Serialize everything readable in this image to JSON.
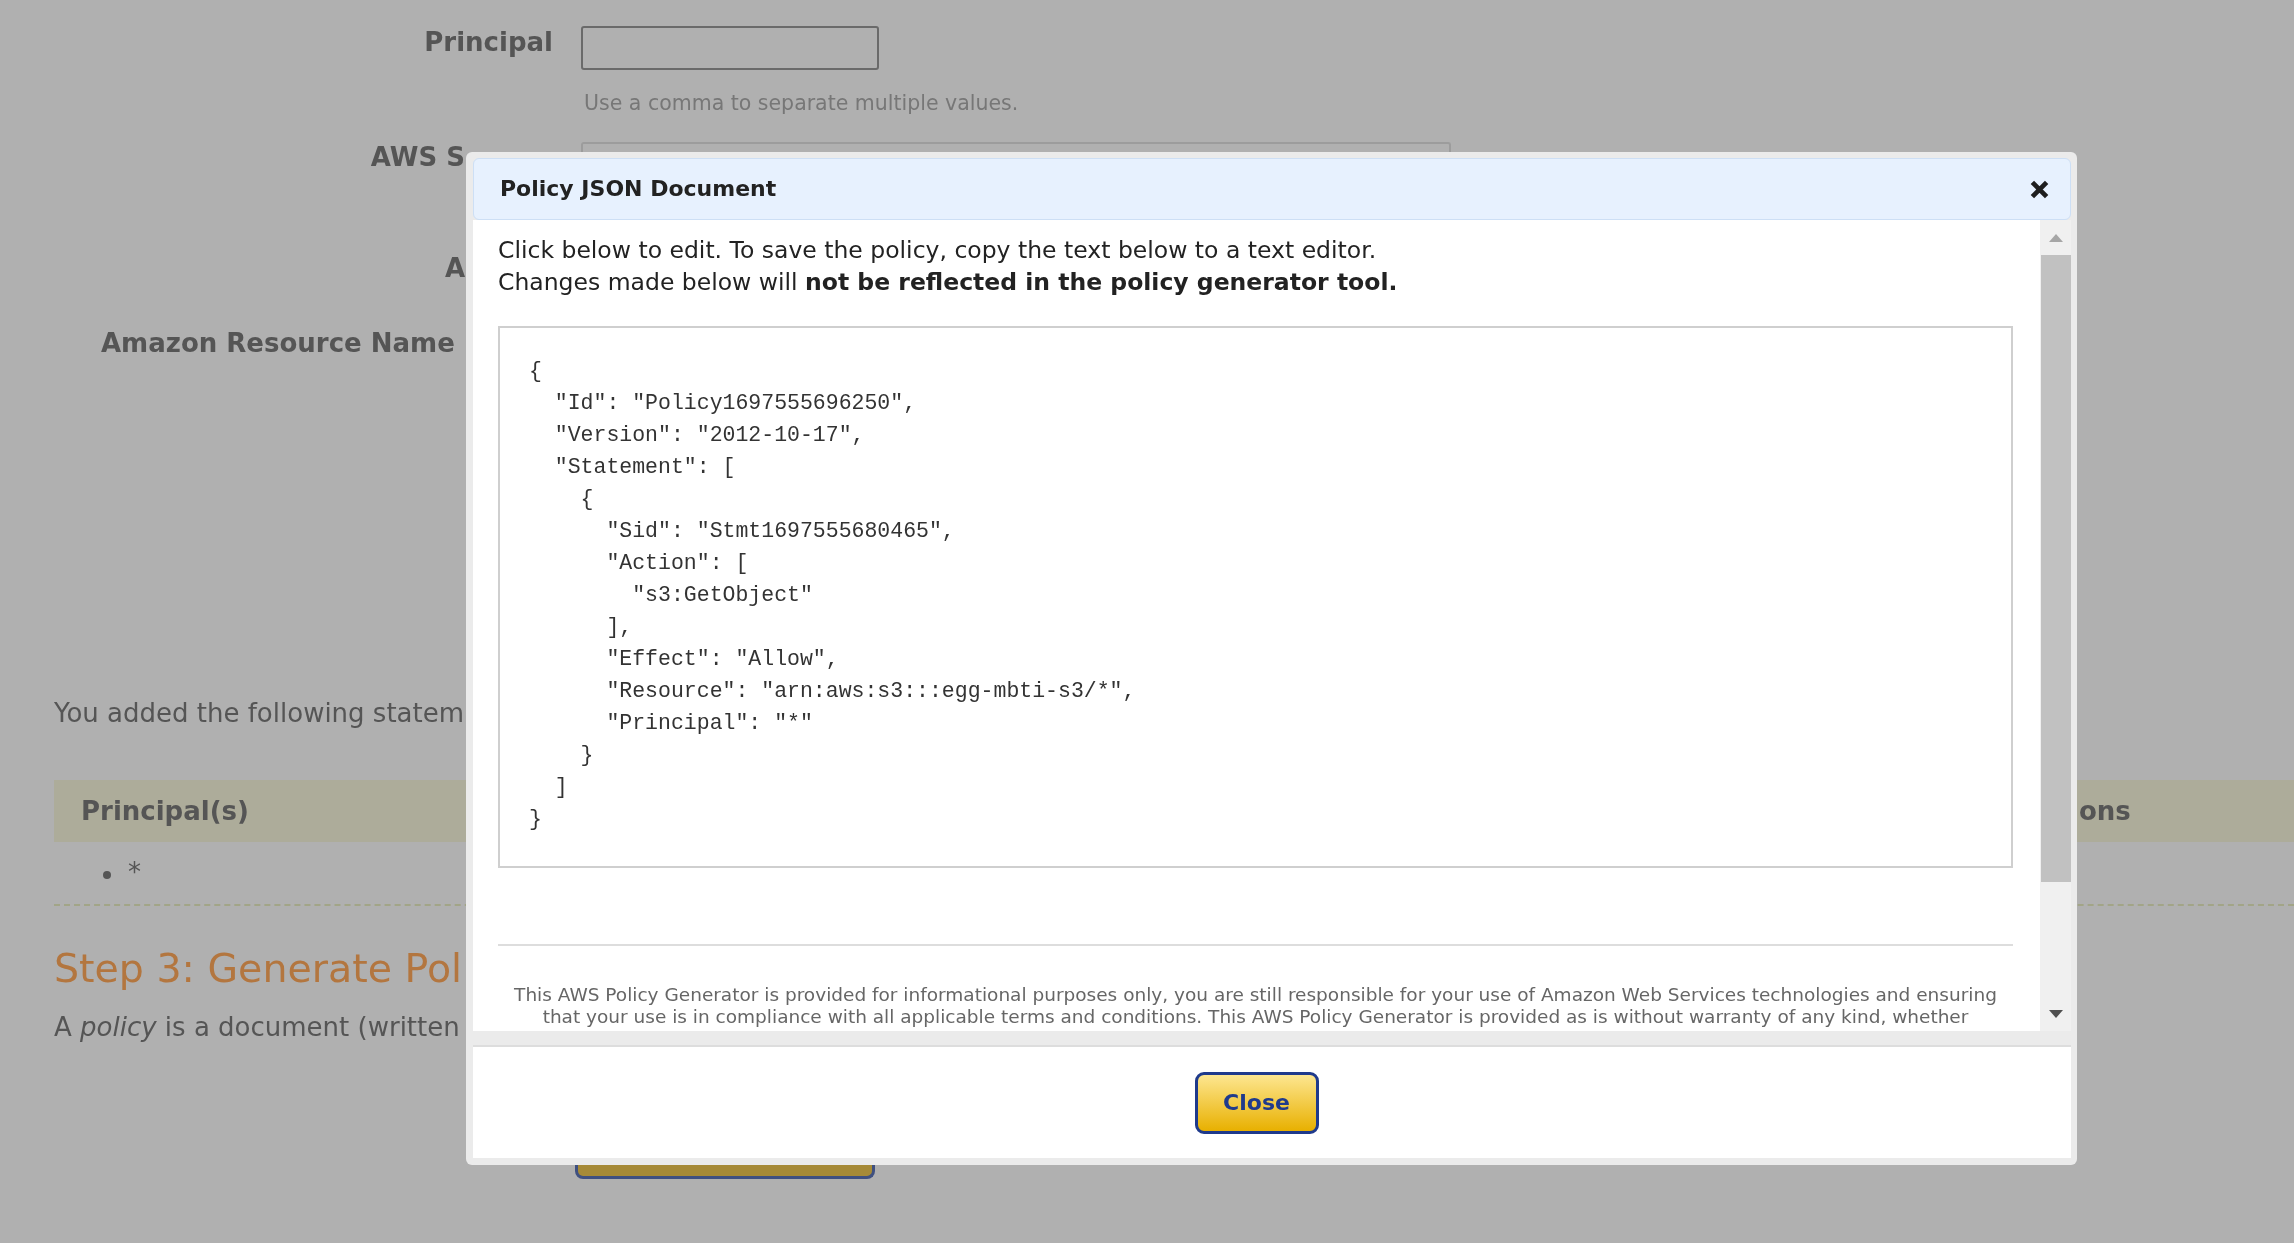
{
  "page": {
    "form_rows": [
      {
        "kind": "text_field",
        "label": "Principal",
        "hint": "Use a comma to separate multiple values."
      },
      {
        "kind": "covered_field",
        "label": "AWS S"
      },
      {
        "kind": "covered_label",
        "label": "A"
      },
      {
        "kind": "label",
        "label": "Amazon Resource Name"
      }
    ],
    "statements_intro": "You added the following statem",
    "statements_table": {
      "columns": [
        "Principal(s)",
        "ons"
      ],
      "rows": [
        {
          "principals": [
            "*"
          ]
        }
      ]
    },
    "step3": {
      "heading": "Step 3: Generate Pol",
      "text": "A *policy* is a document (written"
    }
  },
  "dialog": {
    "title": "Policy JSON Document",
    "intro": [
      "Click below to edit. To save the policy, copy the text below to a text editor.",
      "Changes made below will **not be reflected in the policy generator tool.**"
    ],
    "editor": {
      "value": "{\n  \"Id\": \"Policy1697555696250\",\n  \"Version\": \"2012-10-17\",\n  \"Statement\": [\n    {\n      \"Sid\": \"Stmt1697555680465\",\n      \"Action\": [\n        \"s3:GetObject\"\n      ],\n      \"Effect\": \"Allow\",\n      \"Resource\": \"arn:aws:s3:::egg-mbti-s3/*\",\n      \"Principal\": \"*\"\n    }\n  ]\n}"
    },
    "disclaimer": "This AWS Policy Generator is provided for informational purposes only, you are still responsible for your use of Amazon Web Services technologies and ensuring that your use is in compliance with all applicable terms and conditions. This AWS Policy Generator is provided as is without warranty of any kind, whether",
    "buttons": [
      {
        "label": "Close"
      }
    ]
  }
}
